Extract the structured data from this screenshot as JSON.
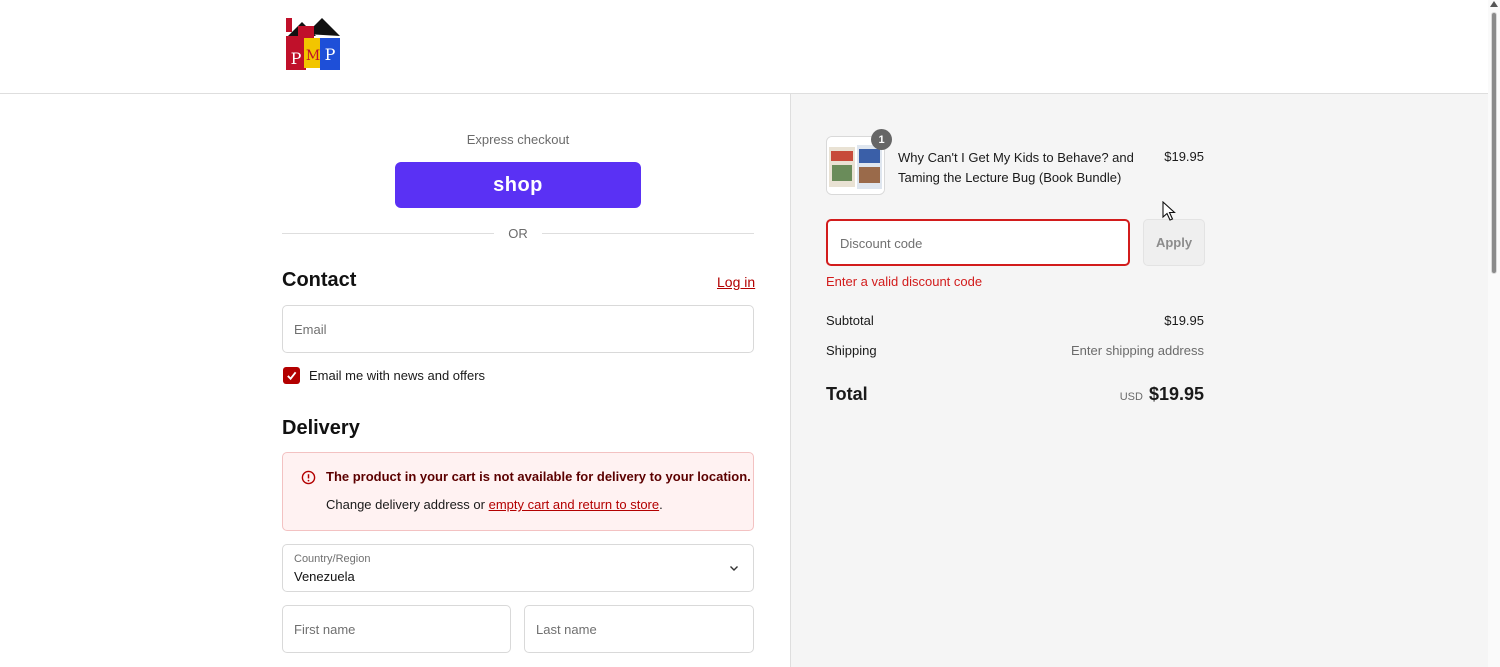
{
  "express": {
    "label": "Express checkout",
    "shop_button": "shop",
    "or_text": "OR"
  },
  "contact": {
    "title": "Contact",
    "login_link": "Log in",
    "email_placeholder": "Email",
    "newsletter_label": "Email me with news and offers",
    "newsletter_checked": true
  },
  "delivery": {
    "title": "Delivery",
    "alert_title": "The product in your cart is not available for delivery to your location.",
    "alert_text": "Change delivery address or ",
    "alert_link": "empty cart and return to store",
    "alert_suffix": ".",
    "country_label": "Country/Region",
    "country_value": "Venezuela",
    "first_name_placeholder": "First name",
    "last_name_placeholder": "Last name"
  },
  "summary": {
    "product": {
      "quantity": "1",
      "title": "Why Can't I Get My Kids to Behave? and Taming the Lecture Bug (Book Bundle)",
      "price": "$19.95"
    },
    "discount_placeholder": "Discount code",
    "apply_label": "Apply",
    "discount_error": "Enter a valid discount code",
    "subtotal_label": "Subtotal",
    "subtotal_value": "$19.95",
    "shipping_label": "Shipping",
    "shipping_value": "Enter shipping address",
    "total_label": "Total",
    "total_currency": "USD",
    "total_value": "$19.95"
  },
  "colors": {
    "brand_link": "#b30000",
    "shop_pay": "#5a31f4",
    "error": "#d21c1c"
  }
}
